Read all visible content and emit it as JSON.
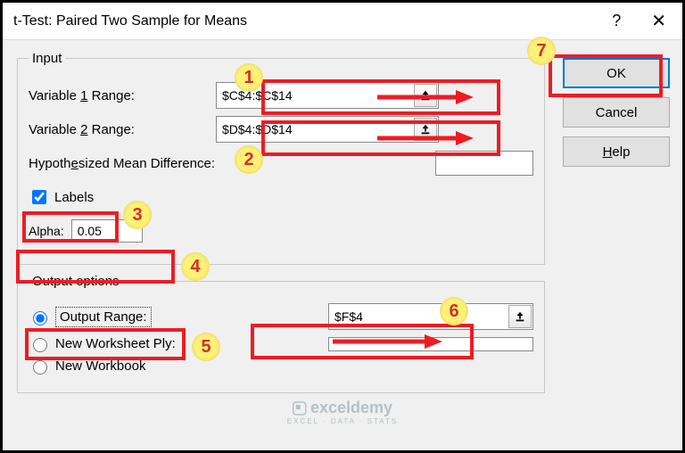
{
  "title": "t-Test: Paired Two Sample for Means",
  "input": {
    "legend": "Input",
    "var1_label_pre": "Variable ",
    "var1_label_u": "1",
    "var1_label_post": " Range:",
    "var1_value": "$C$4:$C$14",
    "var2_label_pre": "Variable ",
    "var2_label_u": "2",
    "var2_label_post": " Range:",
    "var2_value": "$D$4:$D$14",
    "hypo_pre": "Hypoth",
    "hypo_u": "e",
    "hypo_post": "sized Mean Difference:",
    "hypo_value": "",
    "labels_u": "L",
    "labels_post": "abels",
    "labels_checked": true,
    "alpha_u": "A",
    "alpha_post": "lpha:",
    "alpha_value": "0.05"
  },
  "output": {
    "legend": "Output options",
    "range_u": "O",
    "range_post": "utput Range:",
    "range_value": "$F$4",
    "ply_pre": "New Worksheet ",
    "ply_u": "P",
    "ply_post": "ly:",
    "ply_value": "",
    "wb_pre": "New ",
    "wb_u": "W",
    "wb_post": "orkbook"
  },
  "buttons": {
    "ok": "OK",
    "cancel": "Cancel",
    "help_u": "H",
    "help_post": "elp"
  },
  "callouts": {
    "c1": "1",
    "c2": "2",
    "c3": "3",
    "c4": "4",
    "c5": "5",
    "c6": "6",
    "c7": "7"
  },
  "watermark": {
    "brand": "exceldemy",
    "sub": "EXCEL · DATA · STATS"
  }
}
